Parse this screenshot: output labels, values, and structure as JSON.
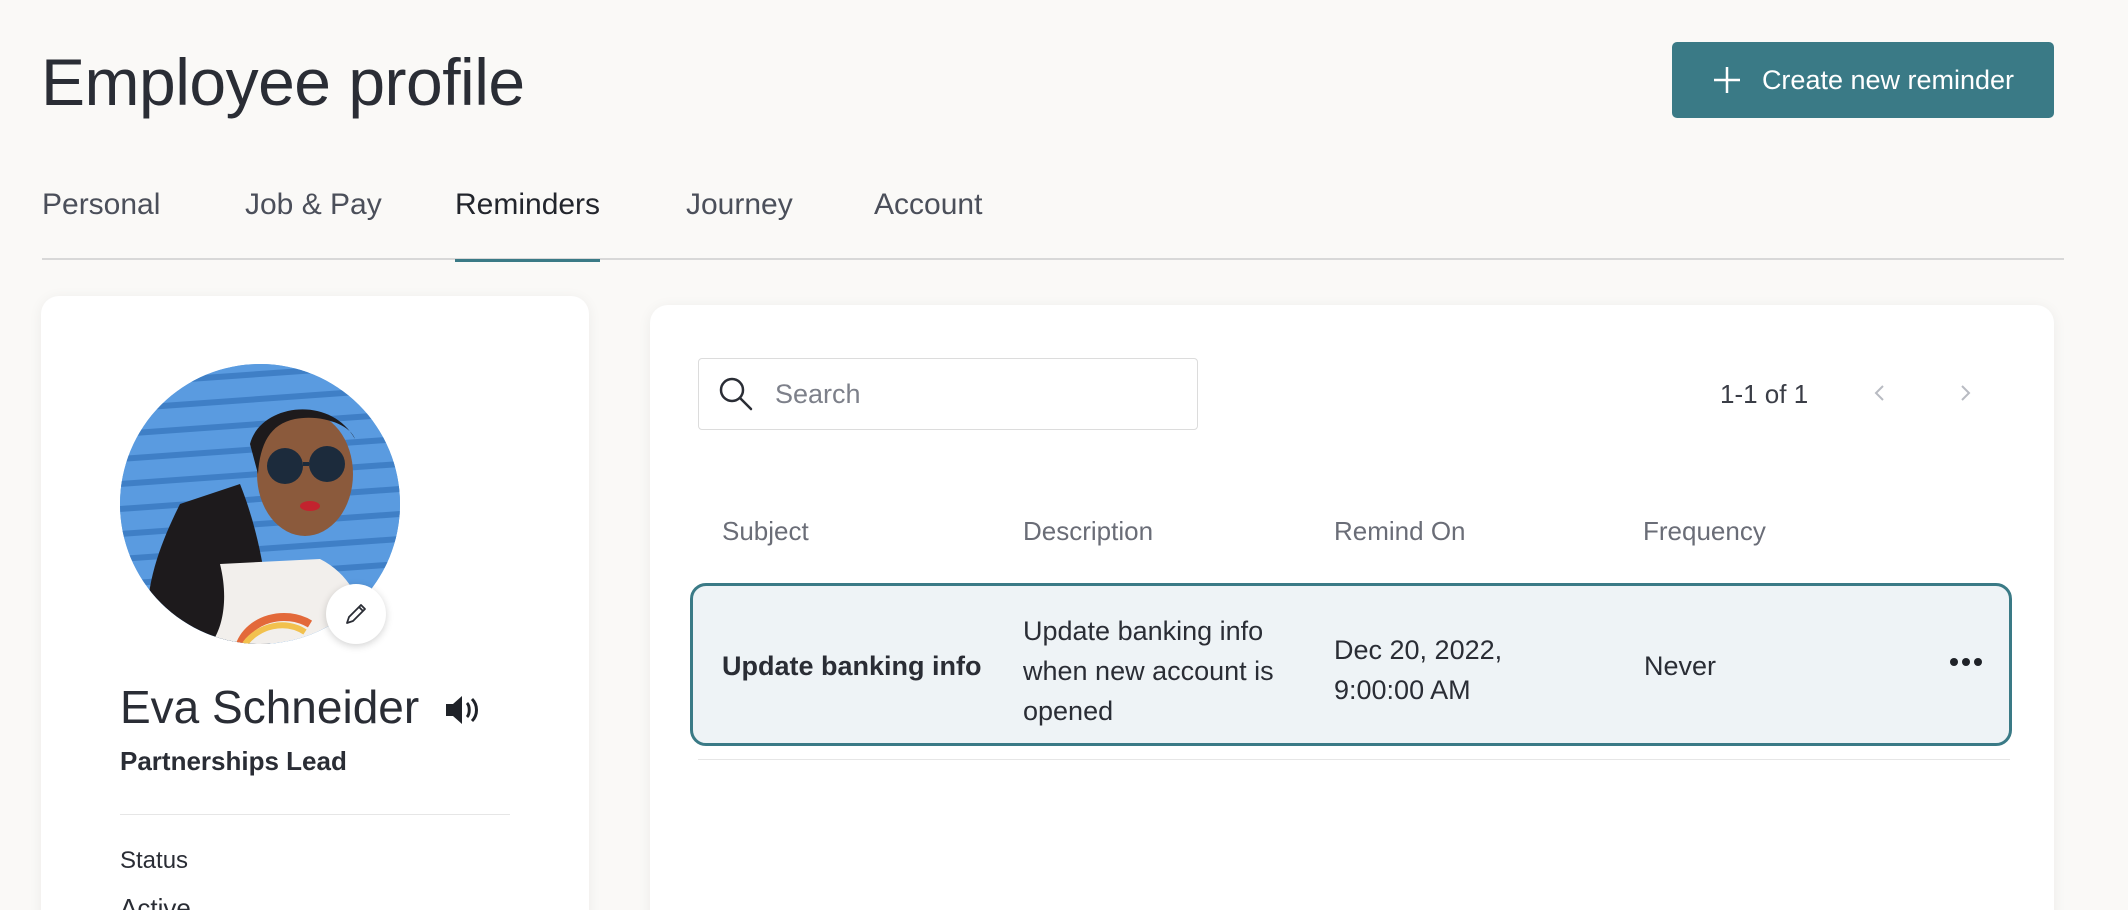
{
  "header": {
    "title": "Employee profile",
    "create_button_label": "Create new reminder"
  },
  "tabs": [
    {
      "label": "Personal",
      "active": false
    },
    {
      "label": "Job & Pay",
      "active": false
    },
    {
      "label": "Reminders",
      "active": true
    },
    {
      "label": "Journey",
      "active": false
    },
    {
      "label": "Account",
      "active": false
    }
  ],
  "profile": {
    "name": "Eva Schneider",
    "role": "Partnerships Lead",
    "status_label": "Status",
    "status_value": "Active"
  },
  "reminders": {
    "search": {
      "placeholder": "Search",
      "value": ""
    },
    "pager": {
      "text": "1-1 of 1"
    },
    "columns": [
      "Subject",
      "Description",
      "Remind On",
      "Frequency"
    ],
    "rows": [
      {
        "subject": "Update banking info",
        "description": "Update banking info when new account is opened",
        "remind_on": "Dec 20, 2022, 9:00:00 AM",
        "frequency": "Never"
      }
    ]
  },
  "icons": {
    "create": "plus-icon",
    "edit_photo": "pencil-icon",
    "pronounce": "speaker-icon",
    "search": "search-icon",
    "prev": "chevron-left-icon",
    "next": "chevron-right-icon",
    "row_menu": "more-horizontal-icon"
  },
  "colors": {
    "accent": "#3a7a86",
    "background": "#faf9f7",
    "row_highlight": "#eef3f6"
  }
}
